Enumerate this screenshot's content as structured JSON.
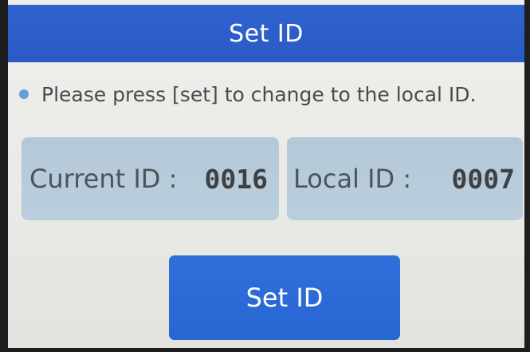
{
  "header": {
    "title": "Set ID"
  },
  "hint": {
    "bullet_icon": "bullet-dot",
    "text": "Please press [set] to change to the local ID."
  },
  "ids": {
    "current": {
      "label": "Current ID :",
      "value": "0016"
    },
    "local": {
      "label": "Local ID :",
      "value": "0007"
    }
  },
  "action": {
    "set_label": "Set ID"
  },
  "colors": {
    "title_bar": "#2f63cf",
    "button": "#2f6fdc",
    "card": "#b4c8d8",
    "bullet": "#5fa0da",
    "screen_bg": "#efefec"
  }
}
